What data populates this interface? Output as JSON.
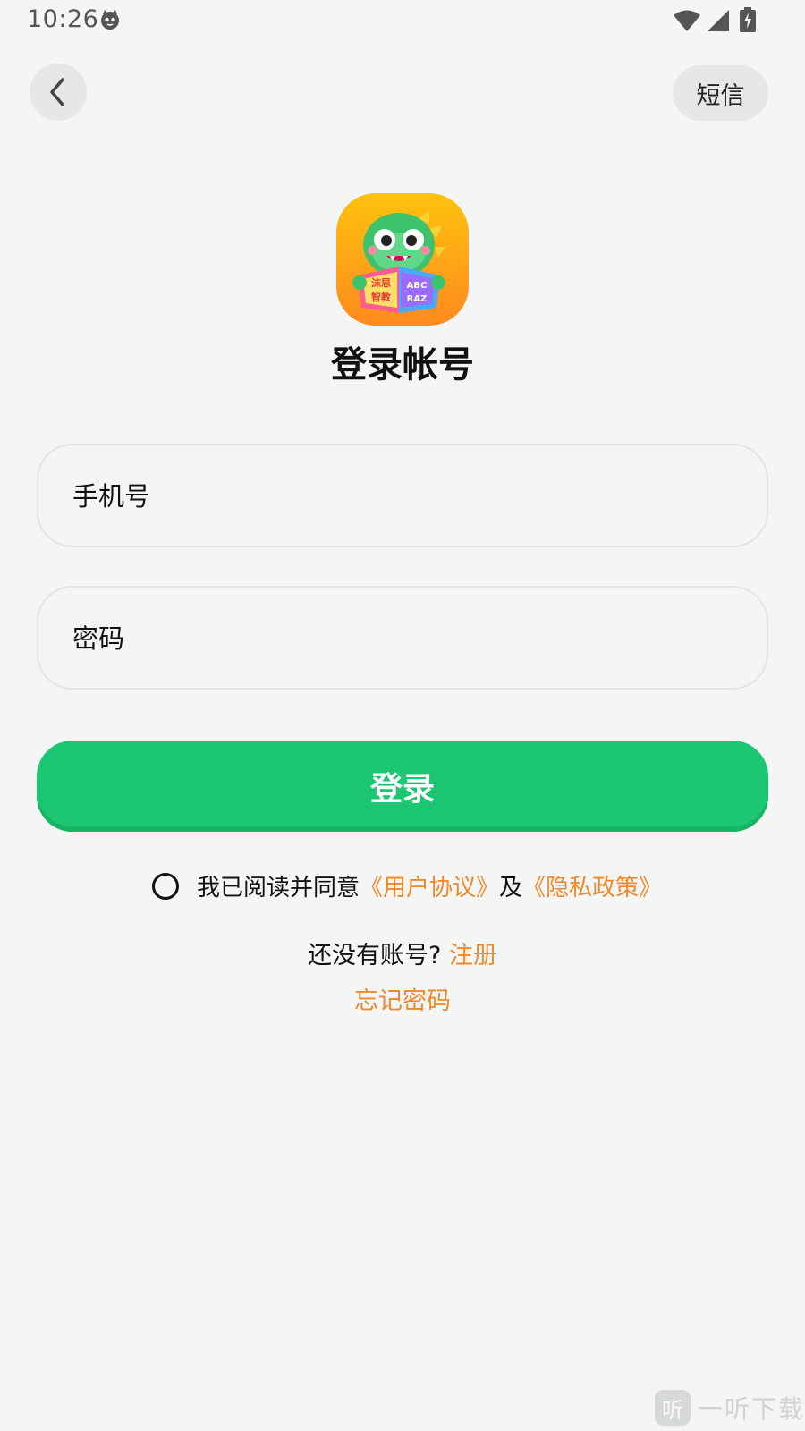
{
  "status_bar": {
    "time": "10:26"
  },
  "nav": {
    "sms_label": "短信"
  },
  "header": {
    "title": "登录帐号",
    "logo_text": [
      "沫思",
      "智教",
      "ABC",
      "RAZ"
    ]
  },
  "form": {
    "phone_placeholder": "手机号",
    "password_placeholder": "密码",
    "login_label": "登录"
  },
  "agreement": {
    "prefix": "我已阅读并同意",
    "user_agreement": "《用户协议》",
    "conjunction": "及",
    "privacy_policy": "《隐私政策》"
  },
  "signup": {
    "question": "还没有账号?",
    "link": "注册"
  },
  "forgot_password": "忘记密码",
  "watermark": {
    "badge": "听",
    "text": "一听下载"
  },
  "colors": {
    "primary_green": "#1cc672",
    "link_orange": "#f0892a",
    "background": "#f4f6f6"
  }
}
